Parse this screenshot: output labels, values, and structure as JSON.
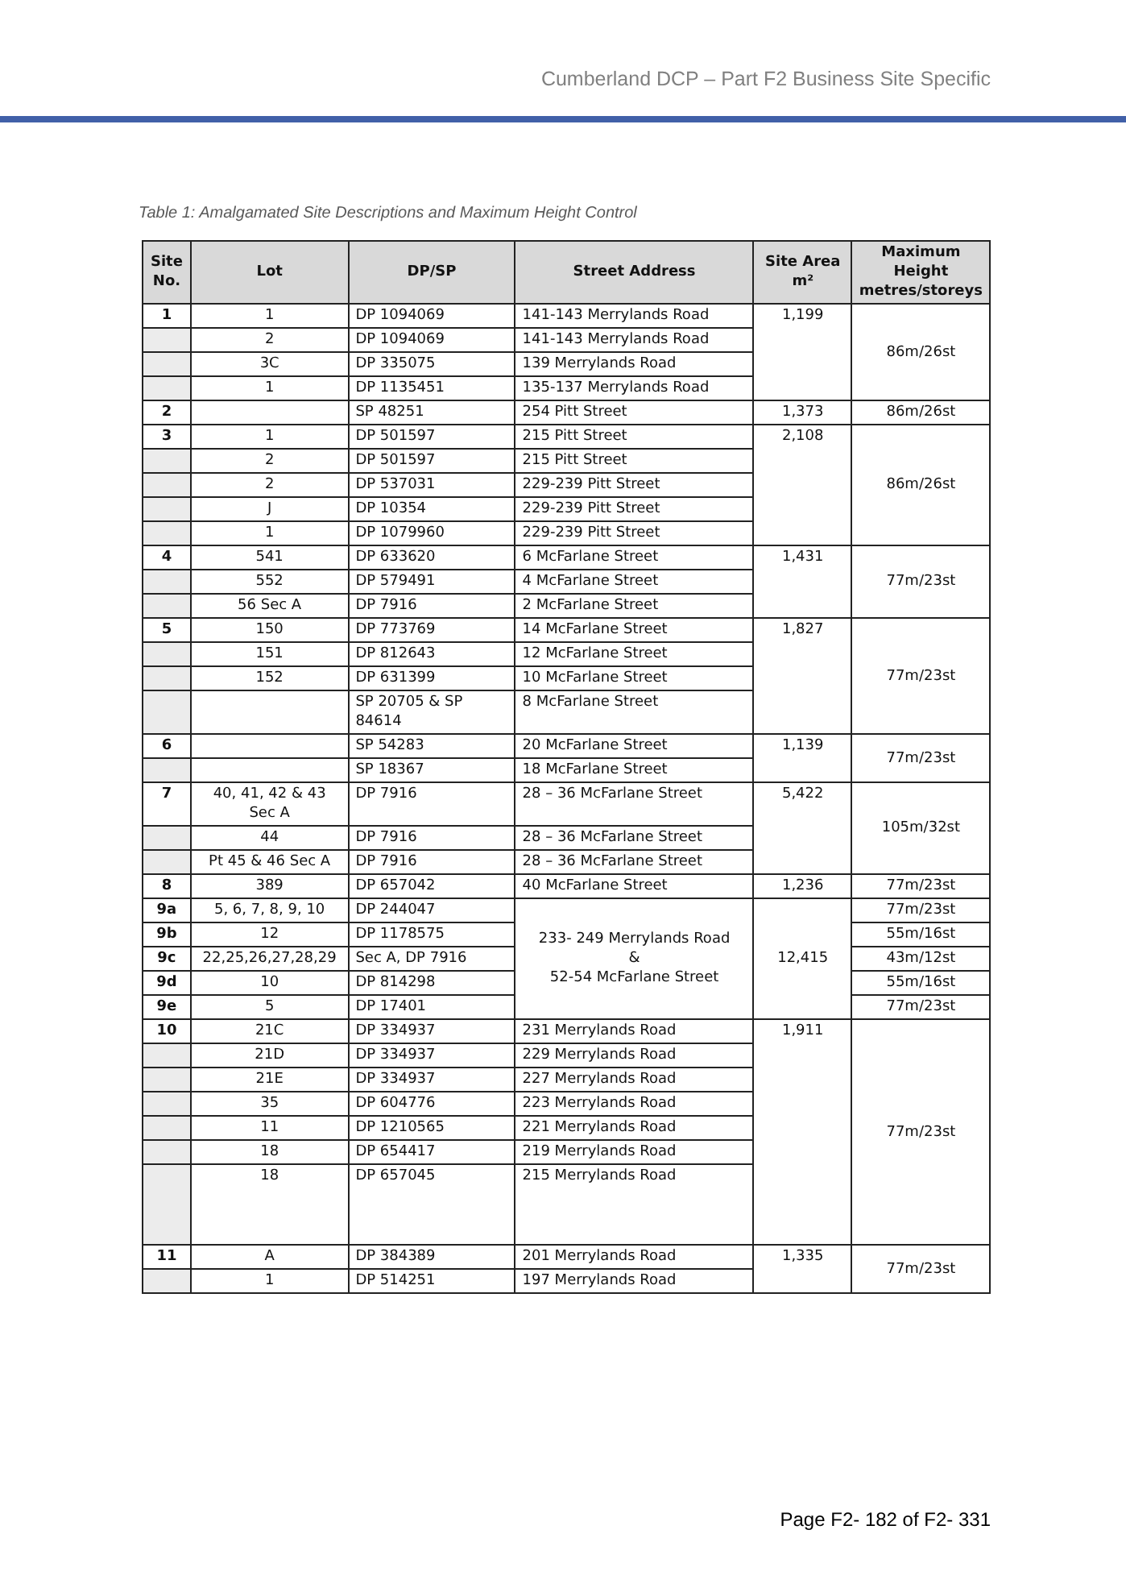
{
  "header": {
    "title": "Cumberland DCP – Part F2 Business Site Specific"
  },
  "caption": "Table 1: Amalgamated Site Descriptions and Maximum Height Control",
  "table": {
    "columns": [
      "Site No.",
      "Lot",
      "DP/SP",
      "Street   Address",
      "Site Area m²",
      "Maximum Height metres/storeys"
    ],
    "groups": [
      {
        "kind": "site",
        "site": "1",
        "area": "1,199",
        "height": "86m/26st",
        "rows": [
          {
            "lot": "1",
            "dp": "DP 1094069",
            "address": "141-143 Merrylands Road"
          },
          {
            "lot": "2",
            "dp": "DP 1094069",
            "address": "141-143 Merrylands Road"
          },
          {
            "lot": "3C",
            "dp": "DP 335075",
            "address": "139 Merrylands Road"
          },
          {
            "lot": "1",
            "dp": "DP 1135451",
            "address": "135-137 Merrylands Road"
          }
        ]
      },
      {
        "kind": "site",
        "site": "2",
        "area": "1,373",
        "height": "86m/26st",
        "rows": [
          {
            "dp": "SP 48251",
            "address": "254 Pitt Street"
          }
        ]
      },
      {
        "kind": "site",
        "site": "3",
        "area": "2,108",
        "height": "86m/26st",
        "rows": [
          {
            "lot": "1",
            "dp": "DP 501597",
            "address": "215 Pitt Street"
          },
          {
            "lot": "2",
            "dp": "DP 501597",
            "address": "215 Pitt Street"
          },
          {
            "lot": "2",
            "dp": "DP 537031",
            "address": "229-239 Pitt Street"
          },
          {
            "lot": "J",
            "dp": "DP 10354",
            "address": "229-239 Pitt Street"
          },
          {
            "lot": "1",
            "dp": "DP 1079960",
            "address": "229-239 Pitt Street"
          }
        ]
      },
      {
        "kind": "site",
        "site": "4",
        "area": "1,431",
        "height": "77m/23st",
        "rows": [
          {
            "lot": "541",
            "dp": "DP 633620",
            "address": "6 McFarlane Street"
          },
          {
            "lot": "552",
            "dp": "DP 579491",
            "address": "4 McFarlane Street"
          },
          {
            "lot": "56 Sec A",
            "dp": "DP 7916",
            "address": "2 McFarlane Street"
          }
        ]
      },
      {
        "kind": "site",
        "site": "5",
        "area": "1,827",
        "height": "77m/23st",
        "rows": [
          {
            "lot": "150",
            "dp": "DP 773769",
            "address": "14 McFarlane Street"
          },
          {
            "lot": "151",
            "dp": "DP 812643",
            "address": "12 McFarlane Street"
          },
          {
            "lot": "152",
            "dp": "DP 631399",
            "address": "10 McFarlane Street"
          },
          {
            "dp": "SP 20705 & SP 84614",
            "address": "8 McFarlane Street"
          }
        ]
      },
      {
        "kind": "site",
        "site": "6",
        "area": "1,139",
        "height": "77m/23st",
        "rows": [
          {
            "dp": "SP 54283",
            "address": "20 McFarlane Street"
          },
          {
            "dp": "SP 18367",
            "address": "18 McFarlane Street"
          }
        ]
      },
      {
        "kind": "site",
        "site": "7",
        "area": "5,422",
        "height": "105m/32st",
        "rows": [
          {
            "lot": "40, 41, 42 & 43 Sec A",
            "dp": "DP 7916",
            "address": "28 – 36 McFarlane Street"
          },
          {
            "lot": "44",
            "dp": "DP 7916",
            "address": "28 – 36 McFarlane Street"
          },
          {
            "lot": "Pt 45 & 46 Sec A",
            "dp": "DP 7916",
            "address": "28 – 36 McFarlane Street"
          }
        ]
      },
      {
        "kind": "site",
        "site": "8",
        "area": "1,236",
        "height": "77m/23st",
        "rows": [
          {
            "lot": "389",
            "dp": "DP 657042",
            "address": "40 McFarlane Street"
          }
        ]
      },
      {
        "kind": "subsites",
        "area": "12,415",
        "address_lines": [
          "233- 249 Merrylands Road",
          "&",
          "52-54 McFarlane Street"
        ],
        "rows": [
          {
            "site": "9a",
            "lot": "5, 6, 7, 8, 9, 10",
            "dp": "DP 244047",
            "height": "77m/23st"
          },
          {
            "site": "9b",
            "lot": "12",
            "dp": "DP 1178575",
            "height": "55m/16st"
          },
          {
            "site": "9c",
            "lot": "22,25,26,27,28,29",
            "dp": "Sec A, DP 7916",
            "height": "43m/12st"
          },
          {
            "site": "9d",
            "lot": "10",
            "dp": "DP 814298",
            "height": "55m/16st"
          },
          {
            "site": "9e",
            "lot": "5",
            "dp": "DP 17401",
            "height": "77m/23st"
          }
        ]
      },
      {
        "kind": "site",
        "site": "10",
        "area": "1,911",
        "height": "77m/23st",
        "rows": [
          {
            "lot": "21C",
            "dp": "DP 334937",
            "address": "231 Merrylands Road"
          },
          {
            "lot": "21D",
            "dp": "DP 334937",
            "address": "229 Merrylands Road"
          },
          {
            "lot": "21E",
            "dp": "DP 334937",
            "address": "227 Merrylands Road"
          },
          {
            "lot": "35",
            "dp": "DP 604776",
            "address": "223 Merrylands Road"
          },
          {
            "lot": "11",
            "dp": "DP 1210565",
            "address": "221 Merrylands Road"
          },
          {
            "lot": "18",
            "dp": "DP 654417",
            "address": "219 Merrylands Road"
          },
          {
            "lot": "18",
            "dp": "DP 657045",
            "address": "215 Merrylands Road"
          }
        ]
      },
      {
        "kind": "site",
        "site": "11",
        "area": "1,335",
        "height": "77m/23st",
        "rows": [
          {
            "lot": "A",
            "dp": "DP 384389",
            "address": "201 Merrylands Road"
          },
          {
            "lot": "1",
            "dp": "DP 514251",
            "address": "197 Merrylands Road"
          }
        ]
      }
    ]
  },
  "footer": {
    "page": "Page F2- 182 of F2- 331"
  }
}
